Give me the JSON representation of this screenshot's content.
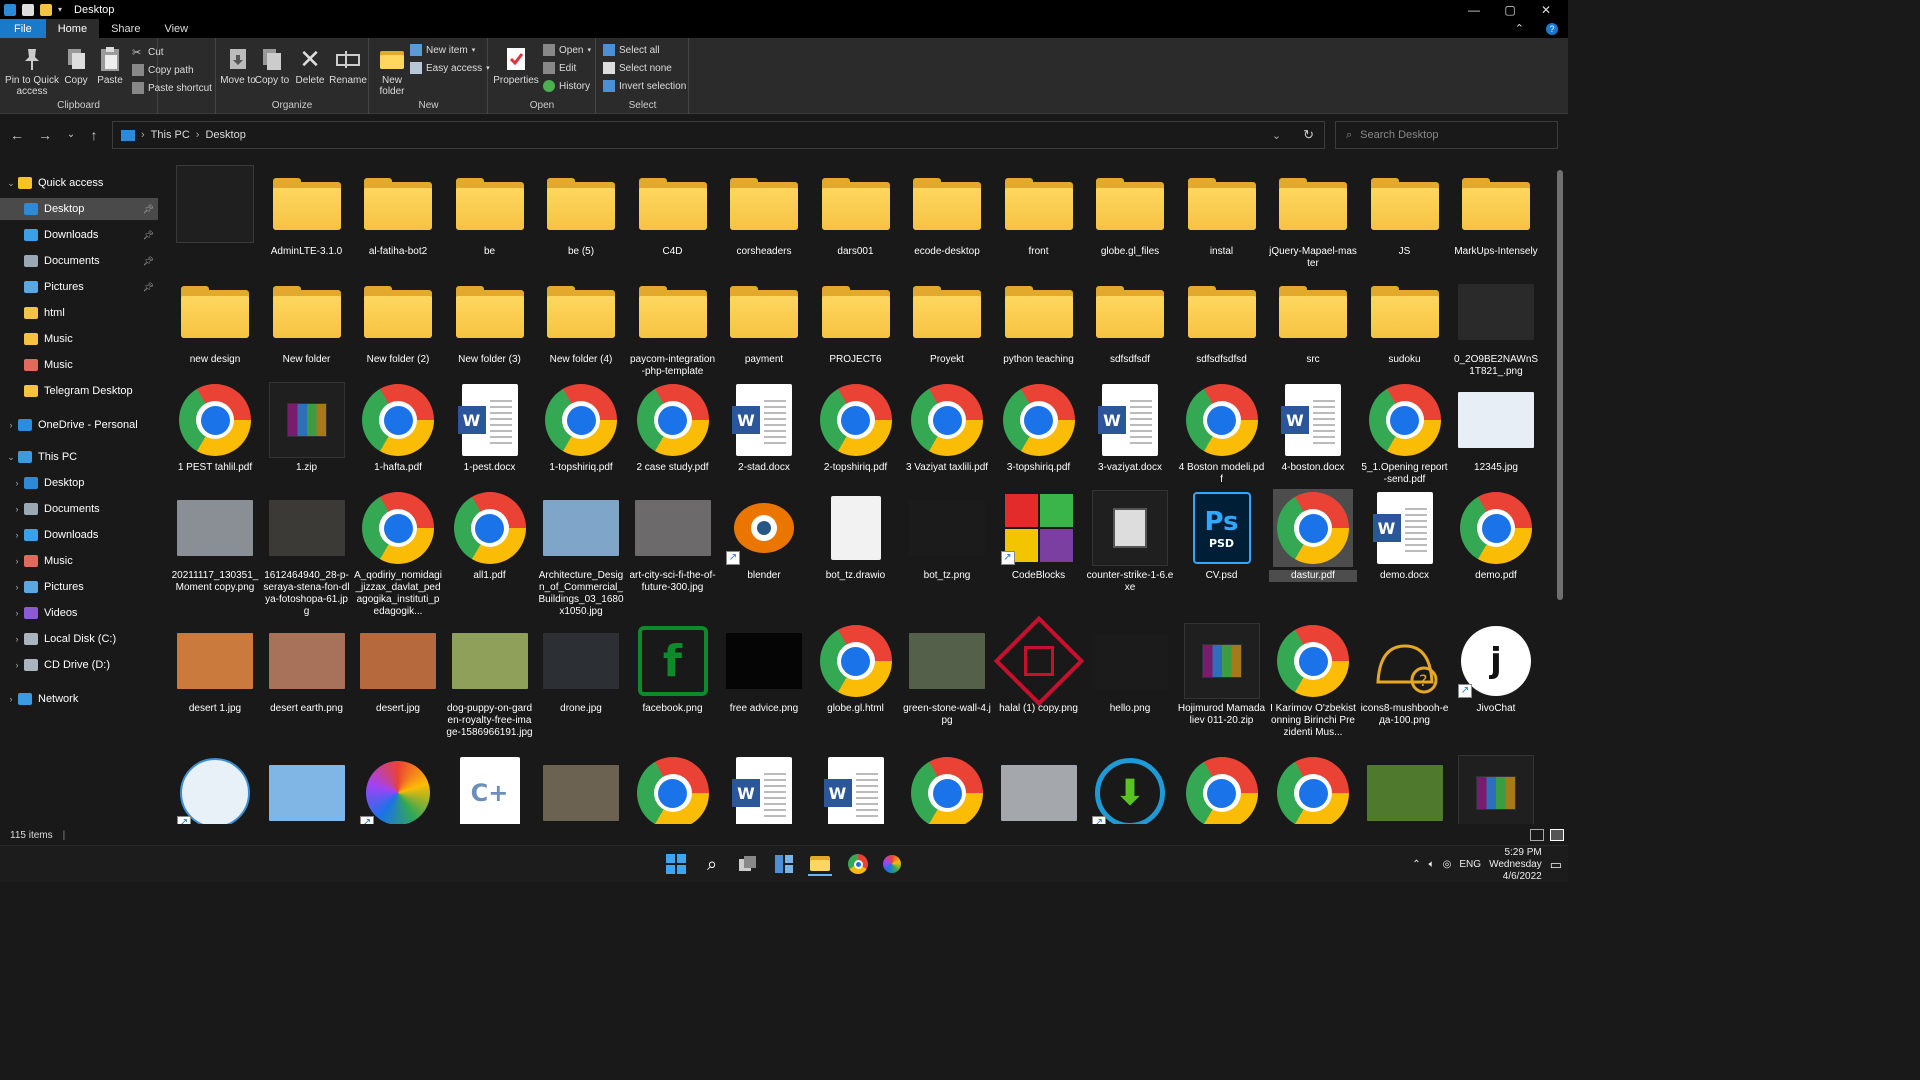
{
  "window": {
    "title": "Desktop",
    "controls": {
      "minimize": "—",
      "maximize": "▢",
      "close": "✕"
    }
  },
  "tabs": [
    {
      "label": "File"
    },
    {
      "label": "Home"
    },
    {
      "label": "Share"
    },
    {
      "label": "View"
    }
  ],
  "ribbon": {
    "clipboard": {
      "label": "Clipboard",
      "pin": "Pin to Quick access",
      "copy": "Copy",
      "paste": "Paste",
      "cut": "Cut",
      "copy_path": "Copy path",
      "paste_shortcut": "Paste shortcut"
    },
    "organize": {
      "label": "Organize",
      "move_to": "Move to",
      "copy_to": "Copy to",
      "delete": "Delete",
      "rename": "Rename"
    },
    "new": {
      "label": "New",
      "new_folder": "New folder",
      "new_item": "New item",
      "easy_access": "Easy access"
    },
    "open": {
      "label": "Open",
      "properties": "Properties",
      "open": "Open",
      "edit": "Edit",
      "history": "History"
    },
    "select": {
      "label": "Select",
      "select_all": "Select all",
      "select_none": "Select none",
      "invert_selection": "Invert selection"
    }
  },
  "address": {
    "crumbs": [
      "This PC",
      "Desktop"
    ],
    "search_placeholder": "Search Desktop"
  },
  "sidebar": [
    {
      "label": "Quick access",
      "level": 0,
      "chev": "⌄",
      "color": "#f7c325"
    },
    {
      "label": "Desktop",
      "level": 1,
      "pinned": true,
      "selected": true,
      "color": "#2c8ad8"
    },
    {
      "label": "Downloads",
      "level": 1,
      "pinned": true,
      "color": "#3aa0e8"
    },
    {
      "label": "Documents",
      "level": 1,
      "pinned": true,
      "color": "#9aa7b5"
    },
    {
      "label": "Pictures",
      "level": 1,
      "pinned": true,
      "color": "#5ba7e2"
    },
    {
      "label": "html",
      "level": 1,
      "color": "#f5c342"
    },
    {
      "label": "Music",
      "level": 1,
      "color": "#f5c342"
    },
    {
      "label": "Music",
      "level": 1,
      "color": "#e26a5c"
    },
    {
      "label": "Telegram Desktop",
      "level": 1,
      "color": "#f5c342"
    },
    {
      "label": "OneDrive - Personal",
      "level": 0,
      "chev": "›",
      "color": "#2a8de0"
    },
    {
      "label": "This PC",
      "level": 0,
      "chev": "⌄",
      "color": "#3c9be0"
    },
    {
      "label": "Desktop",
      "level": 1,
      "chev": "›",
      "color": "#2c8ad8"
    },
    {
      "label": "Documents",
      "level": 1,
      "chev": "›",
      "color": "#9aa7b5"
    },
    {
      "label": "Downloads",
      "level": 1,
      "chev": "›",
      "color": "#3aa0e8"
    },
    {
      "label": "Music",
      "level": 1,
      "chev": "›",
      "color": "#e26a5c"
    },
    {
      "label": "Pictures",
      "level": 1,
      "chev": "›",
      "color": "#5ba7e2"
    },
    {
      "label": "Videos",
      "level": 1,
      "chev": "›",
      "color": "#8a5bd4"
    },
    {
      "label": "Local Disk (C:)",
      "level": 1,
      "chev": "›",
      "color": "#aab4bf"
    },
    {
      "label": "CD Drive (D:)",
      "level": 1,
      "chev": "›",
      "color": "#aab4bf"
    },
    {
      "label": "Network",
      "level": 0,
      "chev": "›",
      "color": "#3c9be0"
    }
  ],
  "items": [
    {
      "label": "",
      "type": "blank"
    },
    {
      "label": "AdminLTE-3.1.0",
      "type": "folder"
    },
    {
      "label": "al-fatiha-bot2",
      "type": "folder"
    },
    {
      "label": "be",
      "type": "folder"
    },
    {
      "label": "be (5)",
      "type": "folder"
    },
    {
      "label": "C4D",
      "type": "folder"
    },
    {
      "label": "corsheaders",
      "type": "folder"
    },
    {
      "label": "dars001",
      "type": "folder"
    },
    {
      "label": "ecode-desktop",
      "type": "folder"
    },
    {
      "label": "front",
      "type": "folder"
    },
    {
      "label": "globe.gl_files",
      "type": "folder"
    },
    {
      "label": "instal",
      "type": "folder"
    },
    {
      "label": "jQuery-Mapael-master",
      "type": "folder"
    },
    {
      "label": "JS",
      "type": "folder"
    },
    {
      "label": "MarkUps-Intensely",
      "type": "folder"
    },
    {
      "label": "new design",
      "type": "folder"
    },
    {
      "label": "New folder",
      "type": "folder"
    },
    {
      "label": "New folder (2)",
      "type": "folder"
    },
    {
      "label": "New folder (3)",
      "type": "folder"
    },
    {
      "label": "New folder (4)",
      "type": "folder"
    },
    {
      "label": "paycom-integration-php-template",
      "type": "folder"
    },
    {
      "label": "payment",
      "type": "folder"
    },
    {
      "label": "PROJECT6",
      "type": "folder"
    },
    {
      "label": "Proyekt",
      "type": "folder"
    },
    {
      "label": "python teaching",
      "type": "folder"
    },
    {
      "label": "sdfsdfsdf",
      "type": "folder"
    },
    {
      "label": "sdfsdfsdfsd",
      "type": "folder"
    },
    {
      "label": "src",
      "type": "folder"
    },
    {
      "label": "sudoku",
      "type": "folder"
    },
    {
      "label": "0_2O9BE2NAWnS1T821_.png",
      "type": "photo",
      "color": "#2a2a2a"
    },
    {
      "label": "1 PEST tahlil.pdf",
      "type": "chrome"
    },
    {
      "label": "1.zip",
      "type": "zip"
    },
    {
      "label": "1-hafta.pdf",
      "type": "chrome"
    },
    {
      "label": "1-pest.docx",
      "type": "word"
    },
    {
      "label": "1-topshiriq.pdf",
      "type": "chrome"
    },
    {
      "label": "2 case study.pdf",
      "type": "chrome"
    },
    {
      "label": "2-stad.docx",
      "type": "word"
    },
    {
      "label": "2-topshiriq.pdf",
      "type": "chrome"
    },
    {
      "label": "3 Vaziyat taxlili.pdf",
      "type": "chrome"
    },
    {
      "label": "3-topshiriq.pdf",
      "type": "chrome"
    },
    {
      "label": "3-vaziyat.docx",
      "type": "word"
    },
    {
      "label": "4 Boston modeli.pdf",
      "type": "chrome"
    },
    {
      "label": "4-boston.docx",
      "type": "word"
    },
    {
      "label": "5_1.Opening report-send.pdf",
      "type": "chrome"
    },
    {
      "label": "12345.jpg",
      "type": "photo",
      "color": "#e8eef5"
    },
    {
      "label": "20211117_130351_Moment copy.png",
      "type": "photo",
      "color": "#8a8f96"
    },
    {
      "label": "1612464940_28-p-seraya-stena-fon-dlya-fotoshopa-61.jpg",
      "type": "photo",
      "color": "#3c3a36"
    },
    {
      "label": "A_qodiriy_nomidagi_jizzax_davlat_pedagogika_instituti_pedagogik...",
      "type": "chrome"
    },
    {
      "label": "all1.pdf",
      "type": "chrome"
    },
    {
      "label": "Architecture_Design_of_Commercial_Buildings_03_1680x1050.jpg",
      "type": "photo",
      "color": "#7fa6c9"
    },
    {
      "label": "art-city-sci-fi-the-of-future-300.jpg",
      "type": "photo",
      "color": "#6d6a6b"
    },
    {
      "label": "blender",
      "type": "blender",
      "shortcut": true
    },
    {
      "label": "bot_tz.drawio",
      "type": "blankdoc"
    },
    {
      "label": "bot_tz.png",
      "type": "photo",
      "color": "#1b1b1b"
    },
    {
      "label": "CodeBlocks",
      "type": "codeblocks",
      "shortcut": true
    },
    {
      "label": "counter-strike-1-6.exe",
      "type": "cs"
    },
    {
      "label": "CV.psd",
      "type": "psd"
    },
    {
      "label": "dastur.pdf",
      "type": "chrome",
      "selected": true
    },
    {
      "label": "demo.docx",
      "type": "word"
    },
    {
      "label": "demo.pdf",
      "type": "chrome"
    },
    {
      "label": "desert 1.jpg",
      "type": "photo",
      "color": "#c97a3c"
    },
    {
      "label": "desert earth.png",
      "type": "photo",
      "color": "#a8725a"
    },
    {
      "label": "desert.jpg",
      "type": "photo",
      "color": "#b5693d"
    },
    {
      "label": "dog-puppy-on-garden-royalty-free-image-1586966191.jpg",
      "type": "photo",
      "color": "#8fa05a"
    },
    {
      "label": "drone.jpg",
      "type": "photo",
      "color": "#2c3034"
    },
    {
      "label": "facebook.png",
      "type": "facebook"
    },
    {
      "label": "free advice.png",
      "type": "photo",
      "color": "#050505"
    },
    {
      "label": "globe.gl.html",
      "type": "chrome"
    },
    {
      "label": "green-stone-wall-4.jpg",
      "type": "photo",
      "color": "#55604a"
    },
    {
      "label": "halal (1) copy.png",
      "type": "halal"
    },
    {
      "label": "hello.png",
      "type": "photo",
      "color": "#1b1b1b"
    },
    {
      "label": "Hojimurod Mamadaliev 011-20.zip",
      "type": "zip"
    },
    {
      "label": "I Karimov O'zbekistonning Birinchi Prezidenti Mus...",
      "type": "chrome"
    },
    {
      "label": "icons8-mushbooh-eда-100.png",
      "type": "mushbooh"
    },
    {
      "label": "JivoChat",
      "type": "jivo",
      "shortcut": true
    },
    {
      "label": "",
      "type": "kangaroo",
      "shortcut": true
    },
    {
      "label": "",
      "type": "photo",
      "color": "#7fb6e6"
    },
    {
      "label": "",
      "type": "photos",
      "shortcut": true
    },
    {
      "label": "",
      "type": "cpp"
    },
    {
      "label": "",
      "type": "photo",
      "color": "#6b6252"
    },
    {
      "label": "",
      "type": "chrome"
    },
    {
      "label": "",
      "type": "word"
    },
    {
      "label": "",
      "type": "word"
    },
    {
      "label": "",
      "type": "chrome"
    },
    {
      "label": "",
      "type": "photo",
      "color": "#a4a7ab"
    },
    {
      "label": "",
      "type": "download",
      "shortcut": true
    },
    {
      "label": "",
      "type": "chrome"
    },
    {
      "label": "",
      "type": "chrome"
    },
    {
      "label": "",
      "type": "photo",
      "color": "#4f7a2e"
    },
    {
      "label": "",
      "type": "zip"
    }
  ],
  "status": {
    "count": "115 items"
  },
  "taskbar": {
    "time": "5:29 PM",
    "day": "Wednesday",
    "date": "4/6/2022",
    "lang": "ENG"
  }
}
